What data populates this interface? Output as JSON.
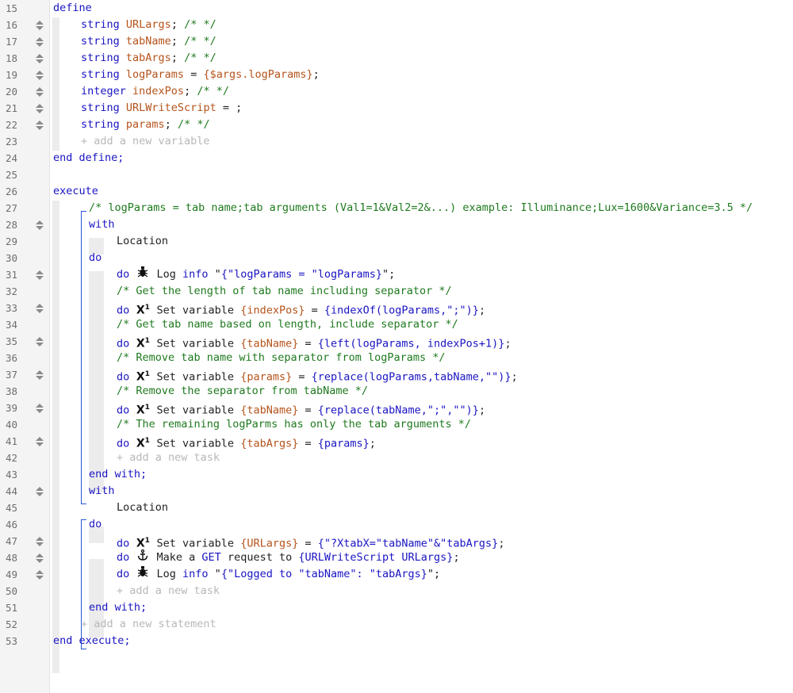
{
  "lines": [
    {
      "n": "15",
      "indent": 0,
      "handle": false,
      "tokens": [
        [
          "kw",
          "define"
        ]
      ]
    },
    {
      "n": "16",
      "indent": 1,
      "handle": true,
      "tokens": [
        [
          "kw",
          "string "
        ],
        [
          "var",
          "URLargs"
        ],
        [
          "plain",
          "; "
        ],
        [
          "cm",
          "/* */"
        ]
      ]
    },
    {
      "n": "17",
      "indent": 1,
      "handle": true,
      "tokens": [
        [
          "kw",
          "string "
        ],
        [
          "var",
          "tabName"
        ],
        [
          "plain",
          "; "
        ],
        [
          "cm",
          "/* */"
        ]
      ]
    },
    {
      "n": "18",
      "indent": 1,
      "handle": true,
      "tokens": [
        [
          "kw",
          "string "
        ],
        [
          "var",
          "tabArgs"
        ],
        [
          "plain",
          "; "
        ],
        [
          "cm",
          "/* */"
        ]
      ]
    },
    {
      "n": "19",
      "indent": 1,
      "handle": true,
      "tokens": [
        [
          "kw",
          "string "
        ],
        [
          "var",
          "logParams"
        ],
        [
          "plain",
          " = "
        ],
        [
          "var",
          "{$args.logParams}"
        ],
        [
          "plain",
          ";"
        ]
      ]
    },
    {
      "n": "20",
      "indent": 1,
      "handle": true,
      "tokens": [
        [
          "kw",
          "integer "
        ],
        [
          "var",
          "indexPos"
        ],
        [
          "plain",
          "; "
        ],
        [
          "cm",
          "/* */"
        ]
      ]
    },
    {
      "n": "21",
      "indent": 1,
      "handle": true,
      "tokens": [
        [
          "kw",
          "string "
        ],
        [
          "var",
          "URLWriteScript"
        ],
        [
          "plain",
          " = ;"
        ]
      ]
    },
    {
      "n": "22",
      "indent": 1,
      "handle": true,
      "tokens": [
        [
          "kw",
          "string "
        ],
        [
          "var",
          "params"
        ],
        [
          "plain",
          "; "
        ],
        [
          "cm",
          "/* */"
        ]
      ]
    },
    {
      "n": "23",
      "indent": 1,
      "handle": false,
      "tokens": [
        [
          "hint",
          "+ add a new variable"
        ]
      ]
    },
    {
      "n": "24",
      "indent": 0,
      "handle": false,
      "tokens": [
        [
          "kw",
          "end define;"
        ]
      ]
    },
    {
      "n": "25",
      "indent": 0,
      "handle": false,
      "tokens": []
    },
    {
      "n": "26",
      "indent": 0,
      "handle": false,
      "tokens": [
        [
          "kw",
          "execute"
        ]
      ]
    },
    {
      "n": "27",
      "indent": 2,
      "handle": false,
      "tokens": [
        [
          "cm",
          "/* logParams = tab name;tab arguments (Val1=1&Val2=2&...) example: Illuminance;Lux=1600&Variance=3.5 */"
        ]
      ]
    },
    {
      "n": "28",
      "indent": 2,
      "handle": true,
      "tokens": [
        [
          "kw",
          "with"
        ]
      ]
    },
    {
      "n": "29",
      "indent": 3,
      "handle": false,
      "tokens": [
        [
          "plain",
          "Location"
        ]
      ]
    },
    {
      "n": "30",
      "indent": 2,
      "handle": false,
      "tokens": [
        [
          "kw",
          "do"
        ]
      ]
    },
    {
      "n": "31",
      "indent": 3,
      "handle": true,
      "icon": "bug",
      "tokens": [
        [
          "kw",
          "do "
        ],
        [
          "icon",
          ""
        ],
        [
          "plain",
          " Log "
        ],
        [
          "kw",
          "info"
        ],
        [
          "plain",
          " \""
        ],
        [
          "str",
          "{\"logParams = \"logParams}"
        ],
        [
          "plain",
          "\";"
        ]
      ]
    },
    {
      "n": "32",
      "indent": 3,
      "handle": false,
      "tokens": [
        [
          "cm",
          "/* Get the length of tab name including separator */"
        ]
      ]
    },
    {
      "n": "33",
      "indent": 3,
      "handle": true,
      "icon": "x1",
      "tokens": [
        [
          "kw",
          "do "
        ],
        [
          "icon",
          ""
        ],
        [
          "plain",
          " Set variable "
        ],
        [
          "var",
          "{indexPos}"
        ],
        [
          "plain",
          " = "
        ],
        [
          "str",
          "{indexOf(logParams,\";\")}"
        ],
        [
          "plain",
          ";"
        ]
      ]
    },
    {
      "n": "34",
      "indent": 3,
      "handle": false,
      "tokens": [
        [
          "cm",
          "/* Get tab name based on length, include separator */"
        ]
      ]
    },
    {
      "n": "35",
      "indent": 3,
      "handle": true,
      "icon": "x1",
      "tokens": [
        [
          "kw",
          "do "
        ],
        [
          "icon",
          ""
        ],
        [
          "plain",
          " Set variable "
        ],
        [
          "var",
          "{tabName}"
        ],
        [
          "plain",
          " = "
        ],
        [
          "str",
          "{left(logParams, indexPos+1)}"
        ],
        [
          "plain",
          ";"
        ]
      ]
    },
    {
      "n": "36",
      "indent": 3,
      "handle": false,
      "tokens": [
        [
          "cm",
          "/* Remove tab name with separator from logParams */"
        ]
      ]
    },
    {
      "n": "37",
      "indent": 3,
      "handle": true,
      "icon": "x1",
      "tokens": [
        [
          "kw",
          "do "
        ],
        [
          "icon",
          ""
        ],
        [
          "plain",
          " Set variable "
        ],
        [
          "var",
          "{params}"
        ],
        [
          "plain",
          " = "
        ],
        [
          "str",
          "{replace(logParams,tabName,\"\")}"
        ],
        [
          "plain",
          ";"
        ]
      ]
    },
    {
      "n": "38",
      "indent": 3,
      "handle": false,
      "tokens": [
        [
          "cm",
          "/* Remove the separator from tabName */"
        ]
      ]
    },
    {
      "n": "39",
      "indent": 3,
      "handle": true,
      "icon": "x1",
      "tokens": [
        [
          "kw",
          "do "
        ],
        [
          "icon",
          ""
        ],
        [
          "plain",
          " Set variable "
        ],
        [
          "var",
          "{tabName}"
        ],
        [
          "plain",
          " = "
        ],
        [
          "str",
          "{replace(tabName,\";\",\"\")}"
        ],
        [
          "plain",
          ";"
        ]
      ]
    },
    {
      "n": "40",
      "indent": 3,
      "handle": false,
      "tokens": [
        [
          "cm",
          "/* The remaining logParms has only the tab arguments */"
        ]
      ]
    },
    {
      "n": "41",
      "indent": 3,
      "handle": true,
      "icon": "x1",
      "tokens": [
        [
          "kw",
          "do "
        ],
        [
          "icon",
          ""
        ],
        [
          "plain",
          " Set variable "
        ],
        [
          "var",
          "{tabArgs}"
        ],
        [
          "plain",
          " = "
        ],
        [
          "str",
          "{params}"
        ],
        [
          "plain",
          ";"
        ]
      ]
    },
    {
      "n": "42",
      "indent": 3,
      "handle": false,
      "tokens": [
        [
          "hint",
          "+ add a new task"
        ]
      ]
    },
    {
      "n": "43",
      "indent": 2,
      "handle": false,
      "tokens": [
        [
          "kw",
          "end with;"
        ]
      ]
    },
    {
      "n": "44",
      "indent": 2,
      "handle": true,
      "tokens": [
        [
          "kw",
          "with"
        ]
      ]
    },
    {
      "n": "45",
      "indent": 3,
      "handle": false,
      "tokens": [
        [
          "plain",
          "Location"
        ]
      ]
    },
    {
      "n": "46",
      "indent": 2,
      "handle": false,
      "tokens": [
        [
          "kw",
          "do"
        ]
      ]
    },
    {
      "n": "47",
      "indent": 3,
      "handle": true,
      "icon": "x1",
      "tokens": [
        [
          "kw",
          "do "
        ],
        [
          "icon",
          ""
        ],
        [
          "plain",
          " Set variable "
        ],
        [
          "var",
          "{URLargs}"
        ],
        [
          "plain",
          " = "
        ],
        [
          "str",
          "{\"?XtabX=\"tabName\"&\"tabArgs}"
        ],
        [
          "plain",
          ";"
        ]
      ]
    },
    {
      "n": "48",
      "indent": 3,
      "handle": true,
      "icon": "anchor",
      "tokens": [
        [
          "kw",
          "do "
        ],
        [
          "icon",
          ""
        ],
        [
          "plain",
          " Make a "
        ],
        [
          "kw",
          "GET"
        ],
        [
          "plain",
          " request to "
        ],
        [
          "str",
          "{URLWriteScript URLargs}"
        ],
        [
          "plain",
          ";"
        ]
      ]
    },
    {
      "n": "49",
      "indent": 3,
      "handle": true,
      "icon": "bug",
      "tokens": [
        [
          "kw",
          "do "
        ],
        [
          "icon",
          ""
        ],
        [
          "plain",
          " Log "
        ],
        [
          "kw",
          "info"
        ],
        [
          "plain",
          " \""
        ],
        [
          "str",
          "{\"Logged to \"tabName\": \"tabArgs}"
        ],
        [
          "plain",
          "\";"
        ]
      ]
    },
    {
      "n": "50",
      "indent": 3,
      "handle": false,
      "tokens": [
        [
          "hint",
          "+ add a new task"
        ]
      ]
    },
    {
      "n": "51",
      "indent": 2,
      "handle": false,
      "tokens": [
        [
          "kw",
          "end with;"
        ]
      ]
    },
    {
      "n": "52",
      "indent": 1,
      "handle": false,
      "tokens": [
        [
          "hint",
          "+ add a new statement"
        ]
      ]
    },
    {
      "n": "53",
      "indent": 0,
      "handle": false,
      "tokens": [
        [
          "kw",
          "end execute;"
        ]
      ]
    }
  ],
  "colors": {
    "keyword": "#1a14c2",
    "comment": "#1f7a1f",
    "variable": "#b5531b",
    "hint": "#b8b8b8"
  }
}
